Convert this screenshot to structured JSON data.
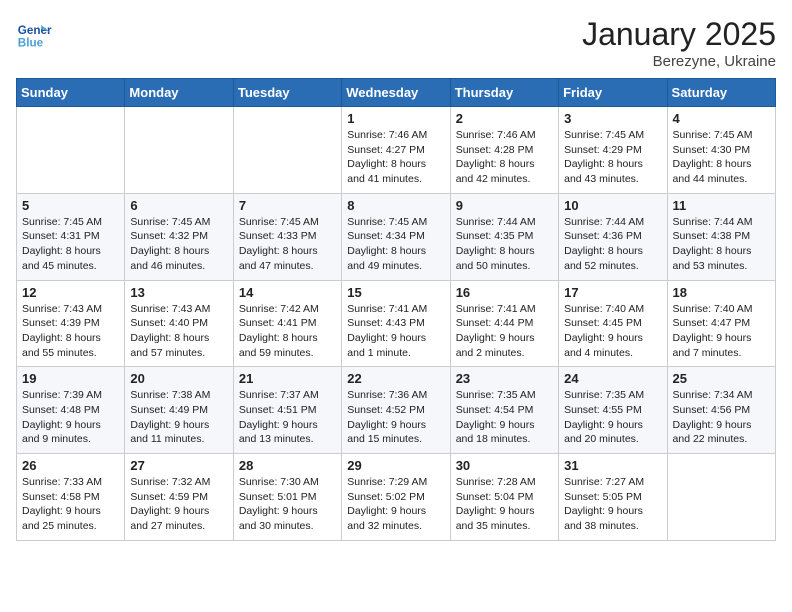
{
  "header": {
    "logo_line1": "General",
    "logo_line2": "Blue",
    "month": "January 2025",
    "location": "Berezyne, Ukraine"
  },
  "weekdays": [
    "Sunday",
    "Monday",
    "Tuesday",
    "Wednesday",
    "Thursday",
    "Friday",
    "Saturday"
  ],
  "weeks": [
    [
      {
        "day": "",
        "info": ""
      },
      {
        "day": "",
        "info": ""
      },
      {
        "day": "",
        "info": ""
      },
      {
        "day": "1",
        "info": "Sunrise: 7:46 AM\nSunset: 4:27 PM\nDaylight: 8 hours and 41 minutes."
      },
      {
        "day": "2",
        "info": "Sunrise: 7:46 AM\nSunset: 4:28 PM\nDaylight: 8 hours and 42 minutes."
      },
      {
        "day": "3",
        "info": "Sunrise: 7:45 AM\nSunset: 4:29 PM\nDaylight: 8 hours and 43 minutes."
      },
      {
        "day": "4",
        "info": "Sunrise: 7:45 AM\nSunset: 4:30 PM\nDaylight: 8 hours and 44 minutes."
      }
    ],
    [
      {
        "day": "5",
        "info": "Sunrise: 7:45 AM\nSunset: 4:31 PM\nDaylight: 8 hours and 45 minutes."
      },
      {
        "day": "6",
        "info": "Sunrise: 7:45 AM\nSunset: 4:32 PM\nDaylight: 8 hours and 46 minutes."
      },
      {
        "day": "7",
        "info": "Sunrise: 7:45 AM\nSunset: 4:33 PM\nDaylight: 8 hours and 47 minutes."
      },
      {
        "day": "8",
        "info": "Sunrise: 7:45 AM\nSunset: 4:34 PM\nDaylight: 8 hours and 49 minutes."
      },
      {
        "day": "9",
        "info": "Sunrise: 7:44 AM\nSunset: 4:35 PM\nDaylight: 8 hours and 50 minutes."
      },
      {
        "day": "10",
        "info": "Sunrise: 7:44 AM\nSunset: 4:36 PM\nDaylight: 8 hours and 52 minutes."
      },
      {
        "day": "11",
        "info": "Sunrise: 7:44 AM\nSunset: 4:38 PM\nDaylight: 8 hours and 53 minutes."
      }
    ],
    [
      {
        "day": "12",
        "info": "Sunrise: 7:43 AM\nSunset: 4:39 PM\nDaylight: 8 hours and 55 minutes."
      },
      {
        "day": "13",
        "info": "Sunrise: 7:43 AM\nSunset: 4:40 PM\nDaylight: 8 hours and 57 minutes."
      },
      {
        "day": "14",
        "info": "Sunrise: 7:42 AM\nSunset: 4:41 PM\nDaylight: 8 hours and 59 minutes."
      },
      {
        "day": "15",
        "info": "Sunrise: 7:41 AM\nSunset: 4:43 PM\nDaylight: 9 hours and 1 minute."
      },
      {
        "day": "16",
        "info": "Sunrise: 7:41 AM\nSunset: 4:44 PM\nDaylight: 9 hours and 2 minutes."
      },
      {
        "day": "17",
        "info": "Sunrise: 7:40 AM\nSunset: 4:45 PM\nDaylight: 9 hours and 4 minutes."
      },
      {
        "day": "18",
        "info": "Sunrise: 7:40 AM\nSunset: 4:47 PM\nDaylight: 9 hours and 7 minutes."
      }
    ],
    [
      {
        "day": "19",
        "info": "Sunrise: 7:39 AM\nSunset: 4:48 PM\nDaylight: 9 hours and 9 minutes."
      },
      {
        "day": "20",
        "info": "Sunrise: 7:38 AM\nSunset: 4:49 PM\nDaylight: 9 hours and 11 minutes."
      },
      {
        "day": "21",
        "info": "Sunrise: 7:37 AM\nSunset: 4:51 PM\nDaylight: 9 hours and 13 minutes."
      },
      {
        "day": "22",
        "info": "Sunrise: 7:36 AM\nSunset: 4:52 PM\nDaylight: 9 hours and 15 minutes."
      },
      {
        "day": "23",
        "info": "Sunrise: 7:35 AM\nSunset: 4:54 PM\nDaylight: 9 hours and 18 minutes."
      },
      {
        "day": "24",
        "info": "Sunrise: 7:35 AM\nSunset: 4:55 PM\nDaylight: 9 hours and 20 minutes."
      },
      {
        "day": "25",
        "info": "Sunrise: 7:34 AM\nSunset: 4:56 PM\nDaylight: 9 hours and 22 minutes."
      }
    ],
    [
      {
        "day": "26",
        "info": "Sunrise: 7:33 AM\nSunset: 4:58 PM\nDaylight: 9 hours and 25 minutes."
      },
      {
        "day": "27",
        "info": "Sunrise: 7:32 AM\nSunset: 4:59 PM\nDaylight: 9 hours and 27 minutes."
      },
      {
        "day": "28",
        "info": "Sunrise: 7:30 AM\nSunset: 5:01 PM\nDaylight: 9 hours and 30 minutes."
      },
      {
        "day": "29",
        "info": "Sunrise: 7:29 AM\nSunset: 5:02 PM\nDaylight: 9 hours and 32 minutes."
      },
      {
        "day": "30",
        "info": "Sunrise: 7:28 AM\nSunset: 5:04 PM\nDaylight: 9 hours and 35 minutes."
      },
      {
        "day": "31",
        "info": "Sunrise: 7:27 AM\nSunset: 5:05 PM\nDaylight: 9 hours and 38 minutes."
      },
      {
        "day": "",
        "info": ""
      }
    ]
  ]
}
